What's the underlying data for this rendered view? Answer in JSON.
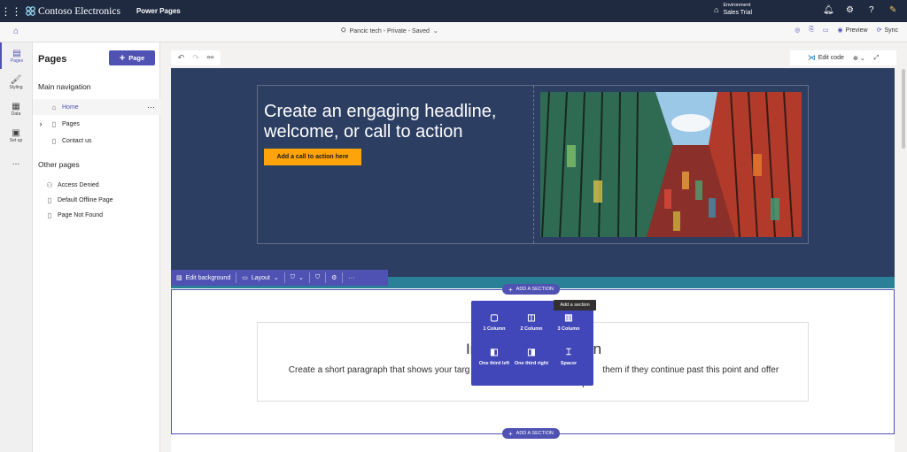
{
  "topbar": {
    "brand": "Contoso Electronics",
    "app_name": "Power Pages",
    "env_label": "Environment",
    "env_value": "Sales Trial"
  },
  "cmdbar": {
    "site_info": "Pancic tech - Private - Saved",
    "preview": "Preview",
    "sync": "Sync"
  },
  "rail": [
    {
      "label": "Pages",
      "icon": "page-icon"
    },
    {
      "label": "Styling",
      "icon": "brush-icon"
    },
    {
      "label": "Data",
      "icon": "table-icon"
    },
    {
      "label": "Set up",
      "icon": "setup-icon"
    },
    {
      "label": "...",
      "icon": "more-icon"
    }
  ],
  "panel": {
    "title": "Pages",
    "add_page": "Page",
    "main_nav_title": "Main navigation",
    "main_nav": [
      "Home",
      "Pages",
      "Contact us"
    ],
    "other_title": "Other pages",
    "other": [
      "Access Denied",
      "Default Offline Page",
      "Page Not Found"
    ]
  },
  "canvas": {
    "edit_code": "Edit code"
  },
  "hero": {
    "headline": "Create an engaging headline, welcome, or call to action",
    "cta": "Add a call to action here"
  },
  "section_toolbar": {
    "edit_background": "Edit background",
    "layout": "Layout"
  },
  "add_section": {
    "label": "ADD A SECTION",
    "tooltip": "Add a section",
    "options": [
      "1 Column",
      "2 Column",
      "3 Column",
      "One third left",
      "One third right",
      "Spacer"
    ]
  },
  "intro": {
    "title_visible_start": "In",
    "title_visible_end": "on",
    "paragraph_left": "Create a short paragraph that shows your targ",
    "paragraph_right": "them if they continue past this point and offer",
    "paragraph_bottom": "direction about the next steps"
  },
  "colors": {
    "accent": "#4f52b2",
    "topbar": "#1f2a40",
    "hero": "#2c3e62",
    "cta": "#ffa30a",
    "teal": "#2a8096"
  }
}
